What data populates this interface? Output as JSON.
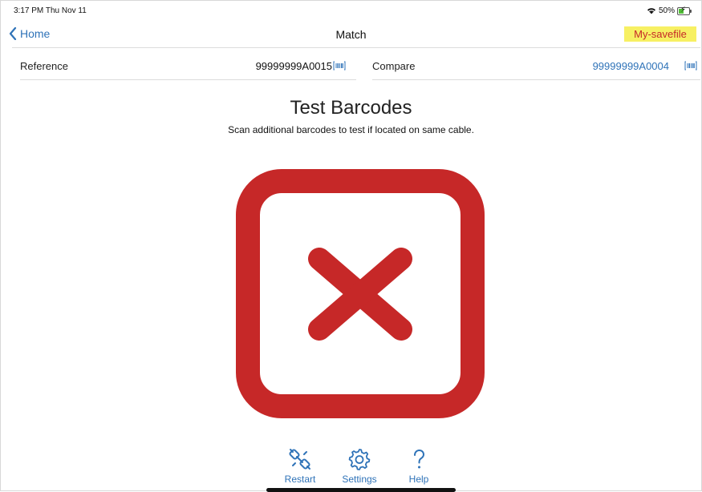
{
  "status": {
    "time": "3:17 PM  Thu Nov 11",
    "battery": "50%",
    "battery_level": 0.5,
    "wifi_icon": "wifi-icon",
    "battery_color": "#52c038"
  },
  "nav": {
    "back_label": "Home",
    "title": "Match",
    "savefile": "My-savefile"
  },
  "reference": {
    "label": "Reference",
    "value": "99999999A0015"
  },
  "compare": {
    "label": "Compare",
    "value": "99999999A0004"
  },
  "main": {
    "heading": "Test Barcodes",
    "subheading": "Scan additional barcodes to test if located on same cable.",
    "result_icon": "failure-x-icon",
    "result_color": "#c62828"
  },
  "toolbar": {
    "restart": "Restart",
    "settings": "Settings",
    "help": "Help"
  },
  "colors": {
    "accent": "#2f73b8",
    "highlight": "#f7f063",
    "error": "#c62828"
  }
}
